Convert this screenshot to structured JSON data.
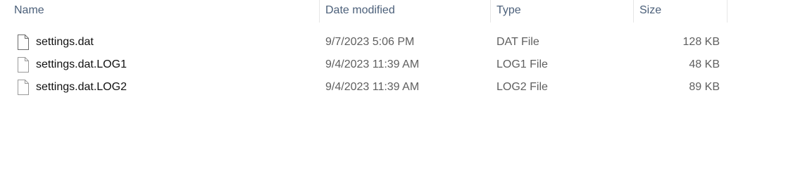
{
  "columns": {
    "name": "Name",
    "date_modified": "Date modified",
    "type": "Type",
    "size": "Size"
  },
  "files": [
    {
      "icon": "file-icon",
      "name": "settings.dat",
      "date_modified": "9/7/2023 5:06 PM",
      "type": "DAT File",
      "size": "128 KB"
    },
    {
      "icon": "file-icon",
      "name": "settings.dat.LOG1",
      "date_modified": "9/4/2023 11:39 AM",
      "type": "LOG1 File",
      "size": "48 KB"
    },
    {
      "icon": "file-icon",
      "name": "settings.dat.LOG2",
      "date_modified": "9/4/2023 11:39 AM",
      "type": "LOG2 File",
      "size": "89 KB"
    }
  ]
}
